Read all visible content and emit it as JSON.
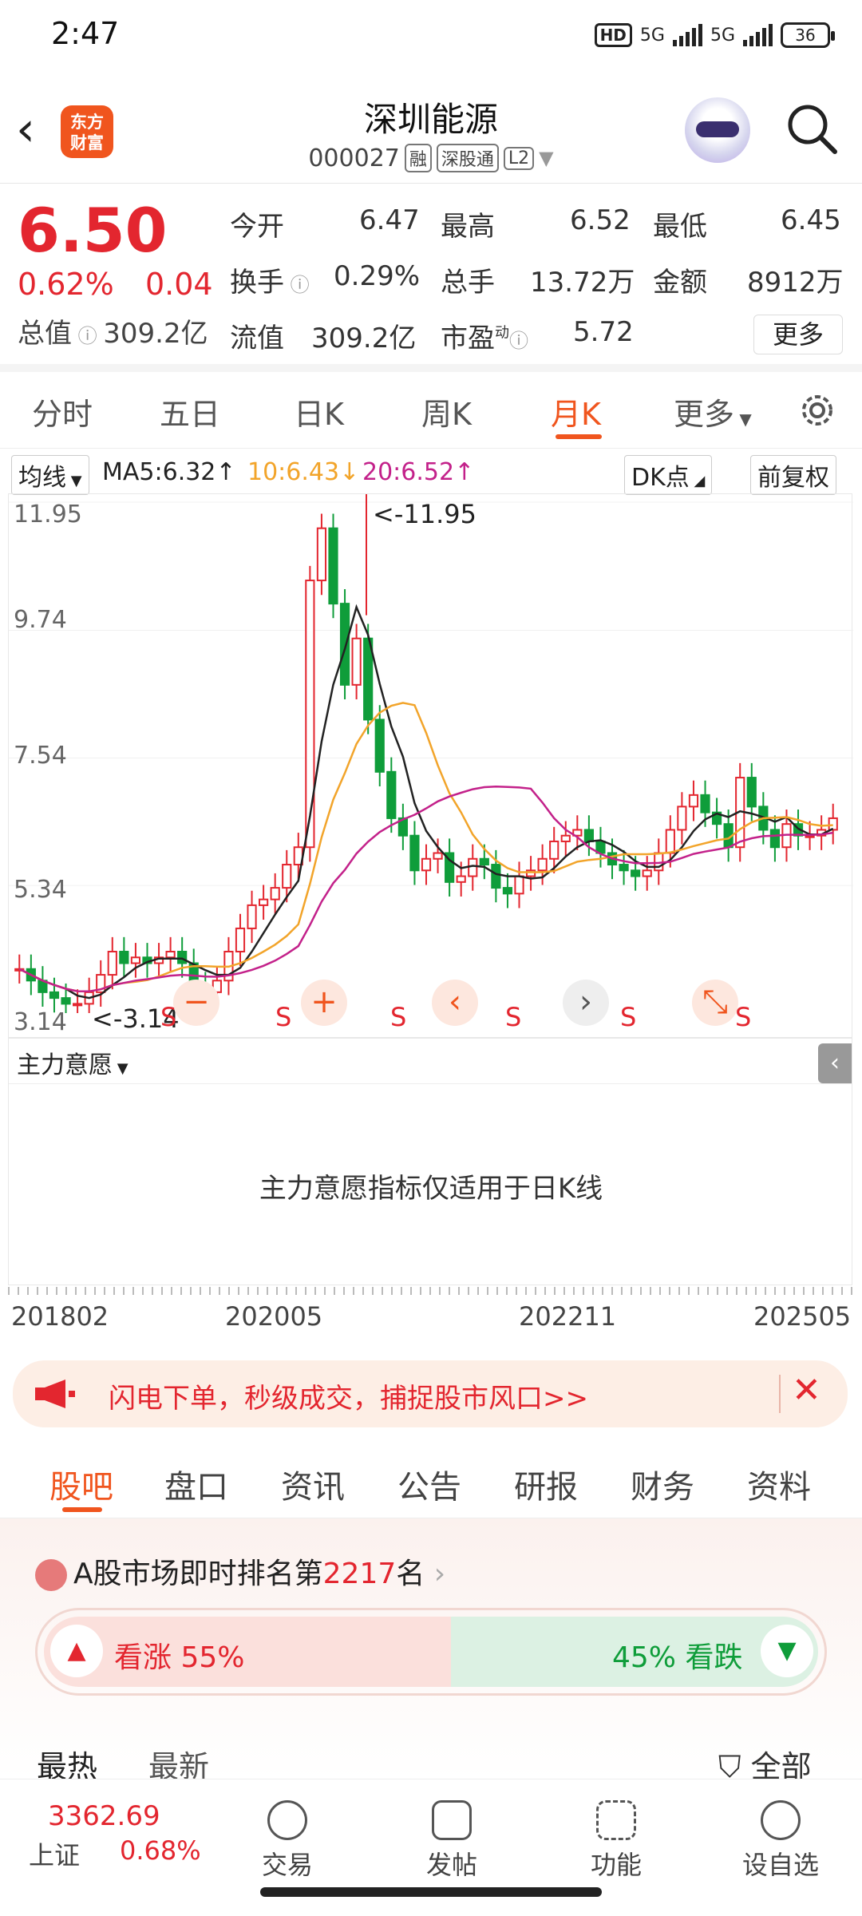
{
  "status_bar": {
    "time": "2:47",
    "hd": "HD",
    "net1": "5G",
    "net2": "5G",
    "battery": "36"
  },
  "header": {
    "logo_line1": "东方",
    "logo_line2": "财富",
    "name": "深圳能源",
    "code": "000027",
    "tags": [
      "融",
      "深股通",
      "L2"
    ]
  },
  "quote": {
    "price": "6.50",
    "change_pct": "0.62%",
    "change": "0.04",
    "open_label": "今开",
    "open": "6.47",
    "high_label": "最高",
    "high": "6.52",
    "low_label": "最低",
    "low": "6.45",
    "turnover_label": "换手",
    "turnover": "0.29%",
    "volume_label": "总手",
    "volume": "13.72万",
    "amount_label": "金额",
    "amount": "8912万",
    "mktcap_label": "总值",
    "mktcap": "309.2亿",
    "float_label": "流值",
    "float": "309.2亿",
    "pe_label": "市盈",
    "pe_sup": "动",
    "pe": "5.72",
    "more": "更多"
  },
  "chart_tabs": [
    "分时",
    "五日",
    "日K",
    "周K",
    "月K",
    "更多"
  ],
  "active_chart_tab": "月K",
  "indicator_bar": {
    "ma_select": "均线",
    "ma5": "MA5:6.32↑",
    "ma10": "10:6.43↓",
    "ma20": "20:6.52↑",
    "dk": "DK点",
    "adjust": "前复权"
  },
  "colors": {
    "up": "#e3262f",
    "down": "#0f9d3a",
    "accent": "#f0551e",
    "ma5": "#222222",
    "ma10": "#f2a42a",
    "ma20": "#c3218a"
  },
  "chart_data": {
    "type": "candlestick",
    "y_ticks": [
      "11.95",
      "9.74",
      "7.54",
      "5.34",
      "3.14"
    ],
    "ylim": [
      3.14,
      11.95
    ],
    "max_label": "<-11.95",
    "min_label": "<-3.14",
    "x_labels": [
      "201802",
      "202005",
      "202211",
      "202505"
    ],
    "signal_label": "S"
  },
  "sub_panel": {
    "select": "主力意愿",
    "message": "主力意愿指标仅适用于日K线"
  },
  "banner": {
    "text": "闪电下单，秒级成交，捕捉股市风口>>"
  },
  "info_tabs": [
    "股吧",
    "盘口",
    "资讯",
    "公告",
    "研报",
    "财务",
    "资料"
  ],
  "community": {
    "rank_prefix": "A股市场即时排名第",
    "rank_num": "2217",
    "rank_suffix": "名",
    "up_label": "看涨 55%",
    "down_label": "45% 看跌",
    "up_pct": 55,
    "hot": "最热",
    "latest": "最新",
    "filter": "全部"
  },
  "bottom": {
    "index_value": "3362.69",
    "index_name": "上证",
    "index_pct": "0.68%",
    "items": [
      "交易",
      "发帖",
      "功能",
      "设自选"
    ]
  }
}
